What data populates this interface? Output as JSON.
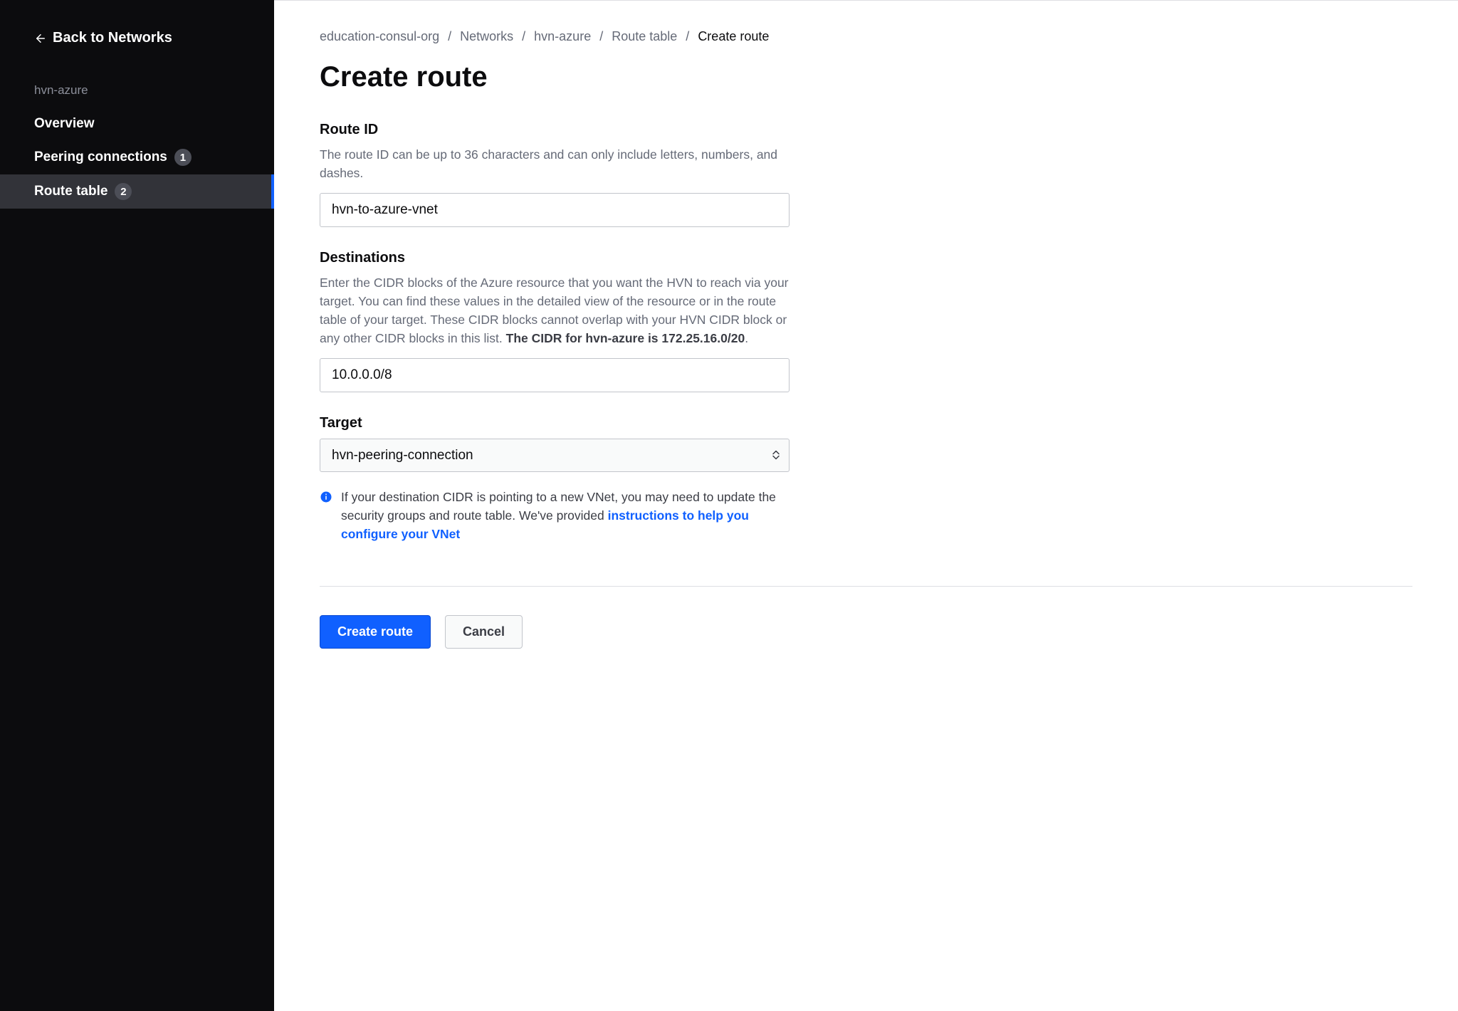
{
  "sidebar": {
    "back_label": "Back to Networks",
    "heading": "hvn-azure",
    "items": [
      {
        "label": "Overview",
        "badge": null,
        "active": false
      },
      {
        "label": "Peering connections",
        "badge": "1",
        "active": false
      },
      {
        "label": "Route table",
        "badge": "2",
        "active": true
      }
    ]
  },
  "breadcrumb": {
    "items": [
      "education-consul-org",
      "Networks",
      "hvn-azure",
      "Route table",
      "Create route"
    ]
  },
  "page": {
    "title": "Create route"
  },
  "form": {
    "route_id": {
      "label": "Route ID",
      "desc": "The route ID can be up to 36 characters and can only include letters, numbers, and dashes.",
      "value": "hvn-to-azure-vnet"
    },
    "destinations": {
      "label": "Destinations",
      "desc_pre": "Enter the CIDR blocks of the Azure resource that you want the HVN to reach via your target. You can find these values in the detailed view of the resource or in the route table of your target. These CIDR blocks cannot overlap with your HVN CIDR block or any other CIDR blocks in this list. ",
      "desc_strong": "The CIDR for hvn-azure is 172.25.16.0/20",
      "desc_post": ".",
      "value": "10.0.0.0/8"
    },
    "target": {
      "label": "Target",
      "value": "hvn-peering-connection"
    },
    "info": {
      "text": "If your destination CIDR is pointing to a new VNet, you may need to update the security groups and route table. We've provided ",
      "link": "instructions to help you configure your VNet"
    },
    "buttons": {
      "primary": "Create route",
      "secondary": "Cancel"
    }
  }
}
